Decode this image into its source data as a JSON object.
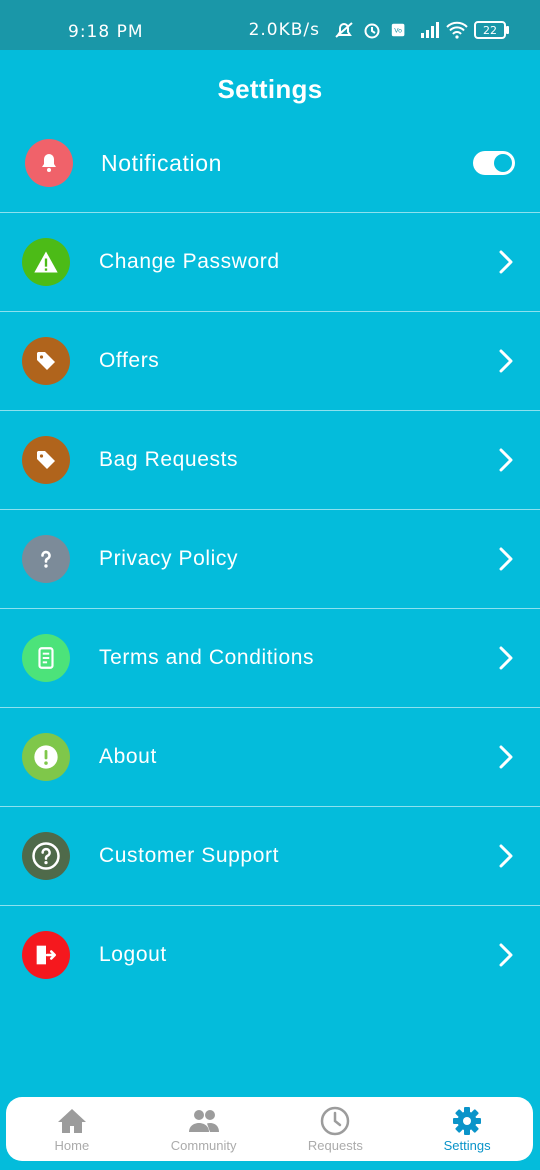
{
  "status_bar": {
    "time": "9:18 PM",
    "network_speed": "2.0KB/s",
    "battery_level": "22"
  },
  "header": {
    "title": "Settings"
  },
  "settings": [
    {
      "label": "Notification",
      "icon": "bell-icon",
      "icon_bg": "#F0626A",
      "control": "toggle",
      "enabled": true
    },
    {
      "label": "Change Password",
      "icon": "warning-icon",
      "icon_bg": "#4CBB17",
      "control": "chevron"
    },
    {
      "label": "Offers",
      "icon": "tag-icon",
      "icon_bg": "#B0641C",
      "control": "chevron"
    },
    {
      "label": "Bag Requests",
      "icon": "tag-icon",
      "icon_bg": "#B0641C",
      "control": "chevron"
    },
    {
      "label": "Privacy Policy",
      "icon": "question-icon",
      "icon_bg": "#7C8B99",
      "control": "chevron"
    },
    {
      "label": "Terms and Conditions",
      "icon": "document-icon",
      "icon_bg": "#4CE37A",
      "control": "chevron"
    },
    {
      "label": "About",
      "icon": "info-icon",
      "icon_bg": "#7FC74A",
      "control": "chevron"
    },
    {
      "label": "Customer Support",
      "icon": "help-circle-icon",
      "icon_bg": "#4F6A4A",
      "control": "chevron"
    },
    {
      "label": "Logout",
      "icon": "logout-icon",
      "icon_bg": "#F5181E",
      "control": "chevron"
    }
  ],
  "bottom_nav": [
    {
      "label": "Home",
      "icon": "home-icon",
      "active": false
    },
    {
      "label": "Community",
      "icon": "community-icon",
      "active": false
    },
    {
      "label": "Requests",
      "icon": "clock-icon",
      "active": false
    },
    {
      "label": "Settings",
      "icon": "gear-icon",
      "active": true
    }
  ],
  "colors": {
    "background": "#04BCDB",
    "status_bar": "#1A97A8",
    "active_nav": "#0A94C9",
    "inactive_nav": "#ABABAB"
  }
}
